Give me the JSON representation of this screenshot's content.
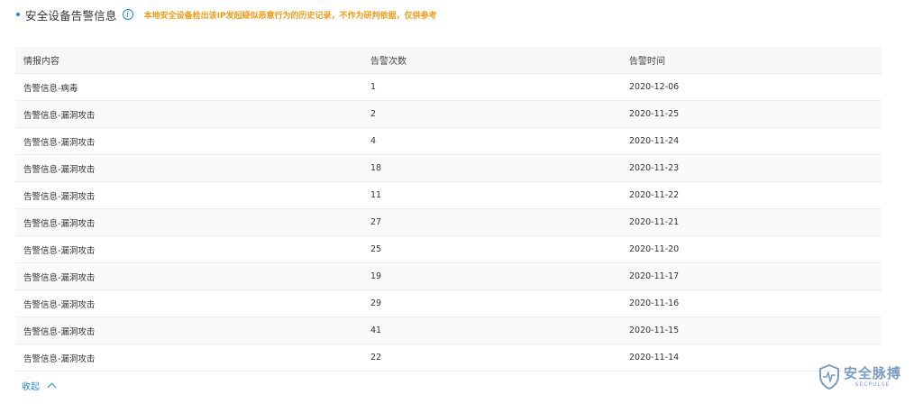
{
  "section": {
    "title": "安全设备告警信息",
    "notice": "本地安全设备检出该IP发起疑似恶意行为的历史记录，不作为研判依据，仅供参考"
  },
  "table": {
    "headers": [
      "情报内容",
      "告警次数",
      "告警时间"
    ],
    "rows": [
      {
        "content": "告警信息-病毒",
        "count": "1",
        "time": "2020-12-06"
      },
      {
        "content": "告警信息-漏洞攻击",
        "count": "2",
        "time": "2020-11-25"
      },
      {
        "content": "告警信息-漏洞攻击",
        "count": "4",
        "time": "2020-11-24"
      },
      {
        "content": "告警信息-漏洞攻击",
        "count": "18",
        "time": "2020-11-23"
      },
      {
        "content": "告警信息-漏洞攻击",
        "count": "11",
        "time": "2020-11-22"
      },
      {
        "content": "告警信息-漏洞攻击",
        "count": "27",
        "time": "2020-11-21"
      },
      {
        "content": "告警信息-漏洞攻击",
        "count": "25",
        "time": "2020-11-20"
      },
      {
        "content": "告警信息-漏洞攻击",
        "count": "19",
        "time": "2020-11-17"
      },
      {
        "content": "告警信息-漏洞攻击",
        "count": "29",
        "time": "2020-11-16"
      },
      {
        "content": "告警信息-漏洞攻击",
        "count": "41",
        "time": "2020-11-15"
      },
      {
        "content": "告警信息-漏洞攻击",
        "count": "22",
        "time": "2020-11-14"
      }
    ]
  },
  "collapse": {
    "label": "收起",
    "icon": "chevron-up-icon"
  },
  "watermark": {
    "cn": "安全脉搏",
    "en": "SECPULSE"
  },
  "colors": {
    "accent": "#1e88e5",
    "notice": "#f39c12",
    "watermark": "#5b84b8"
  }
}
